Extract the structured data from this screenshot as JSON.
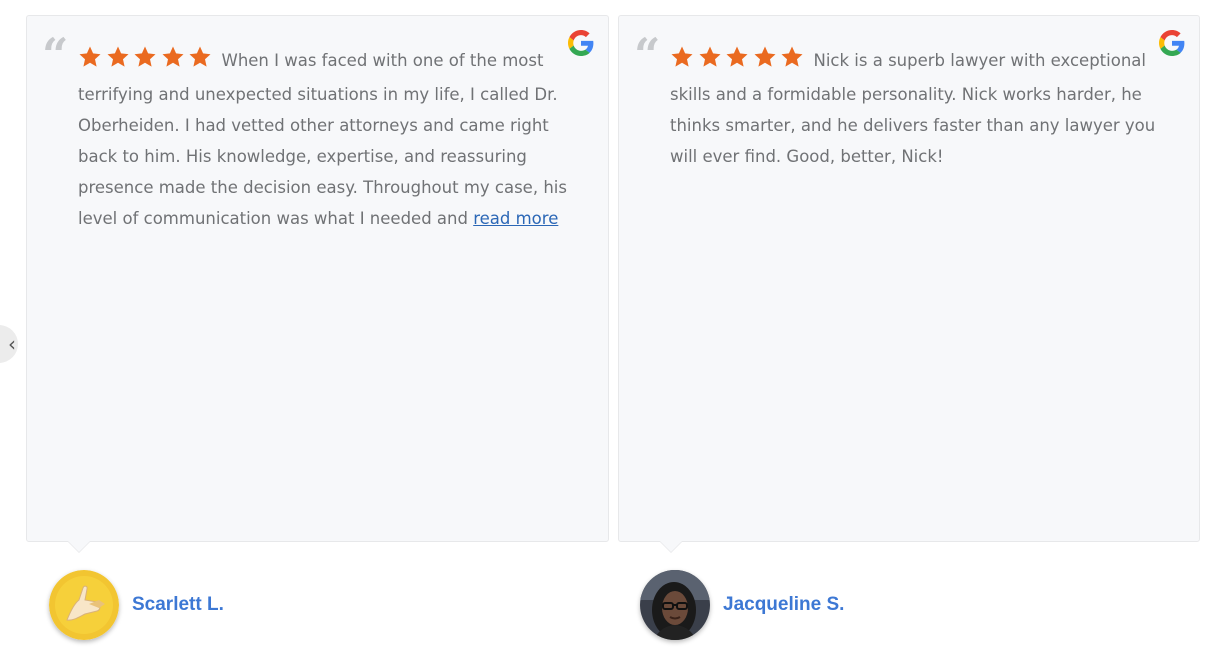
{
  "carousel": {
    "prev_icon": "chevron-left-icon",
    "prev_glyph": "‹"
  },
  "reviews": [
    {
      "rating": 5,
      "source_icon": "google-icon",
      "text": "When I was faced with one of the most terrifying and unexpected situations in my life, I called Dr. Oberheiden. I had vetted other attorneys and came right back to him. His knowledge, expertise, and reassuring presence made the decision easy. Throughout my case, his level of communication was what I needed and ",
      "read_more": "read more",
      "author": "Scarlett L."
    },
    {
      "rating": 5,
      "source_icon": "google-icon",
      "text": "Nick is a superb lawyer with exceptional skills and a formidable personality. Nick works harder, he thinks smarter, and he delivers faster than any lawyer you will ever find. Good, better, Nick!",
      "author": "Jacqueline S."
    }
  ],
  "colors": {
    "star": "#ea6a20",
    "author_name": "#3d78d4",
    "link": "#2b67b6",
    "card_bg": "#f7f8fa",
    "text": "#707275"
  }
}
